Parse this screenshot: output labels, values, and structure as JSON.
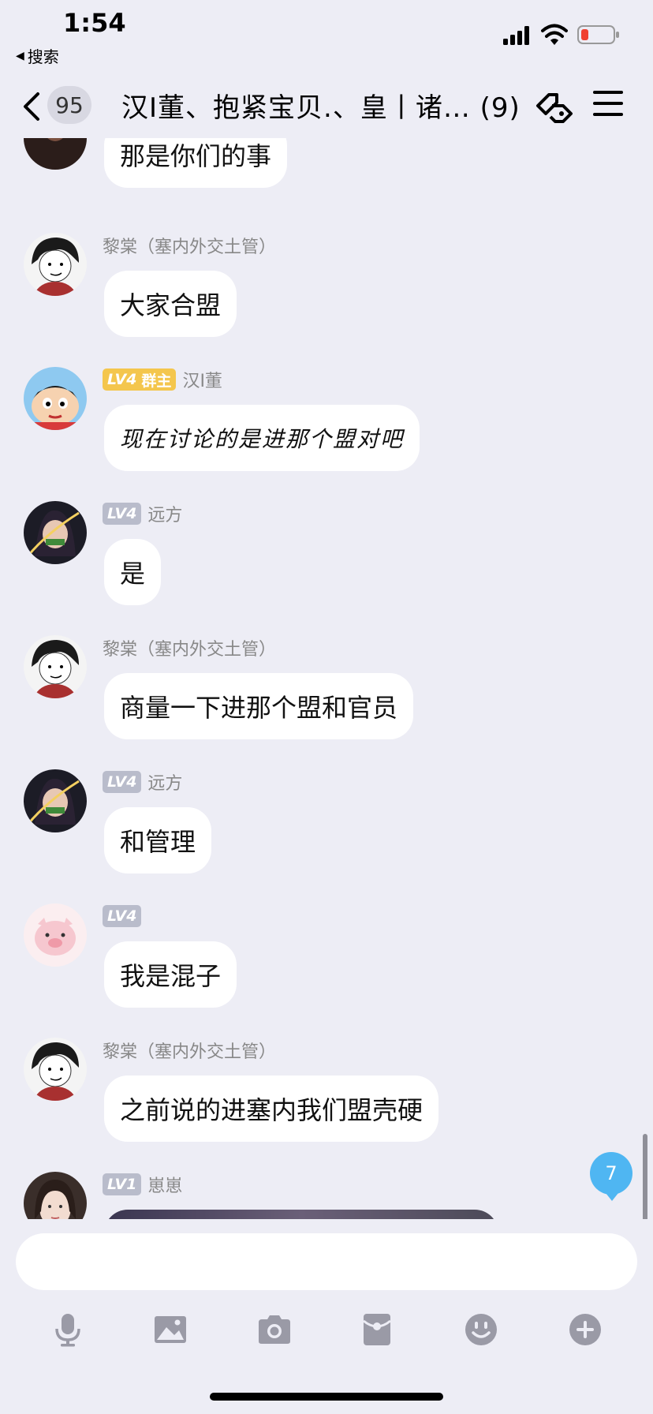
{
  "status": {
    "time": "1:54",
    "back_app": "搜索"
  },
  "nav": {
    "unread_count": "95",
    "title": "汉I董、抱紧宝贝.、皇丨诸… (9)"
  },
  "messages": [
    {
      "sender": "",
      "level": "",
      "role": "",
      "text": "那是你们的事",
      "avatar": "avatar-dark"
    },
    {
      "sender": "黎棠（塞内外交土管）",
      "level": "",
      "role": "",
      "text": "大家合盟",
      "avatar": "avatar-man"
    },
    {
      "sender": "汉I董",
      "level": "LV4",
      "role": "群主",
      "text": "现在讨论的是进那个盟对吧",
      "avatar": "avatar-shinchan"
    },
    {
      "sender": "远方",
      "level": "LV4",
      "role": "",
      "text": "是",
      "avatar": "avatar-girl"
    },
    {
      "sender": "黎棠（塞内外交土管）",
      "level": "",
      "role": "",
      "text": "商量一下进那个盟和官员",
      "avatar": "avatar-man"
    },
    {
      "sender": "远方",
      "level": "LV4",
      "role": "",
      "text": "和管理",
      "avatar": "avatar-girl"
    },
    {
      "sender": "",
      "level": "LV4",
      "role": "",
      "text": "我是混子",
      "avatar": "avatar-pig"
    },
    {
      "sender": "黎棠（塞内外交土管）",
      "level": "",
      "role": "",
      "text": "之前说的进塞内我们盟壳硬",
      "avatar": "avatar-man"
    },
    {
      "sender": "崽崽",
      "level": "LV1",
      "role": "",
      "text": "",
      "avatar": "avatar-woman"
    }
  ],
  "unread_new": "7",
  "input": {
    "value": "",
    "placeholder": ""
  },
  "toolbar": [
    "mic-icon",
    "image-icon",
    "camera-icon",
    "red-packet-icon",
    "emoji-icon",
    "plus-icon"
  ],
  "colors": {
    "background": "#ededf5",
    "owner_badge": "#f4c64d",
    "level_badge": "#b9bccb",
    "new_msg": "#4fb6f2"
  }
}
